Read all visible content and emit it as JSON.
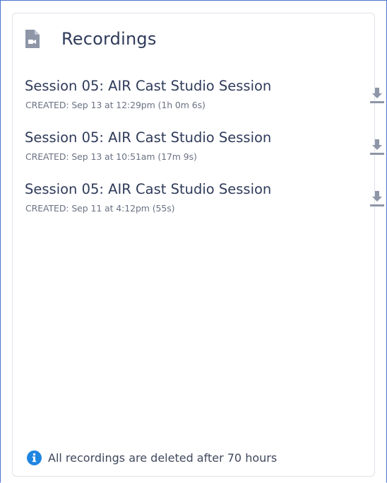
{
  "panel": {
    "title": "Recordings",
    "title_icon": "file-video-icon"
  },
  "recordings": [
    {
      "title": "Session 05: AIR Cast Studio Session",
      "created": "CREATED: Sep 13 at 12:29pm (1h 0m 6s)",
      "action_icon": "download-icon"
    },
    {
      "title": "Session 05: AIR Cast Studio Session",
      "created": "CREATED: Sep 13 at 10:51am (17m 9s)",
      "action_icon": "download-icon"
    },
    {
      "title": "Session 05: AIR Cast Studio Session",
      "created": "CREATED: Sep 11 at 4:12pm (55s)",
      "action_icon": "download-icon"
    }
  ],
  "footer": {
    "icon": "info-icon",
    "text": "All recordings are deleted after 70 hours"
  },
  "colors": {
    "accent": "#1f86e0",
    "icon_gray": "#8e96a8",
    "text_dark": "#2f3b5a",
    "text_muted": "#6a7283",
    "border": "#dfe2e8",
    "frame_border": "#4a74d0"
  }
}
